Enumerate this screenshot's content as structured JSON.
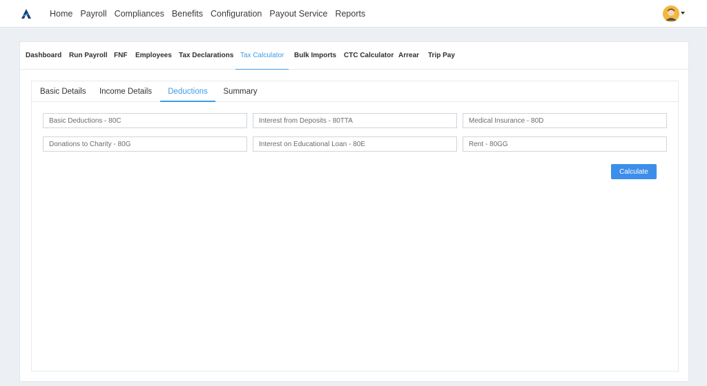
{
  "top_nav": {
    "items": [
      "Home",
      "Payroll",
      "Compliances",
      "Benefits",
      "Configuration",
      "Payout Service",
      "Reports"
    ]
  },
  "sub_nav": {
    "items": [
      "Dashboard",
      "Run Payroll",
      "FNF",
      "Employees",
      "Tax Declarations",
      "Tax Calculator",
      "Bulk Imports",
      "CTC Calculator",
      "Arrear",
      "Trip Pay"
    ],
    "active": "Tax Calculator"
  },
  "tabs": {
    "items": [
      "Basic Details",
      "Income Details",
      "Deductions",
      "Summary"
    ],
    "active": "Deductions"
  },
  "deductions": {
    "basic_80c": "Basic Deductions - 80C",
    "deposits_80tta": "Interest from Deposits - 80TTA",
    "medical_80d": "Medical Insurance - 80D",
    "charity_80g": "Donations to Charity - 80G",
    "edu_loan_80e": "Interest on Educational Loan - 80E",
    "rent_80gg": "Rent - 80GG"
  },
  "actions": {
    "calculate_label": "Calculate"
  },
  "colors": {
    "accent": "#3d9bea",
    "button": "#3d8eea",
    "avatar_bg": "#f4b63e"
  }
}
